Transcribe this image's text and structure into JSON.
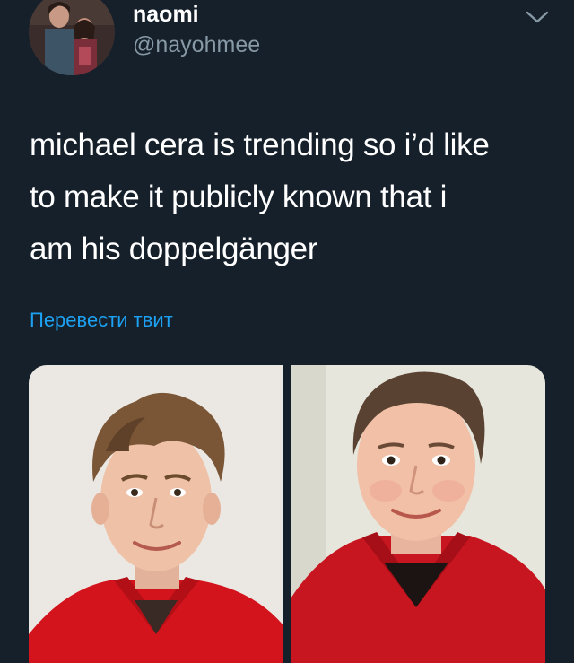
{
  "author": {
    "display_name": "naomi",
    "handle": "@nayohmee"
  },
  "tweet": {
    "text_lines": [
      "michael cera is trending so i’d like",
      "to make it publicly known that i",
      "am his doppelgänger"
    ],
    "translate_label": "Перевести твит"
  },
  "colors": {
    "background": "#15202b",
    "text": "#ffffff",
    "secondary_text": "#8899a6",
    "link": "#1da1f2"
  },
  "icons": {
    "menu": "chevron-down-icon"
  }
}
